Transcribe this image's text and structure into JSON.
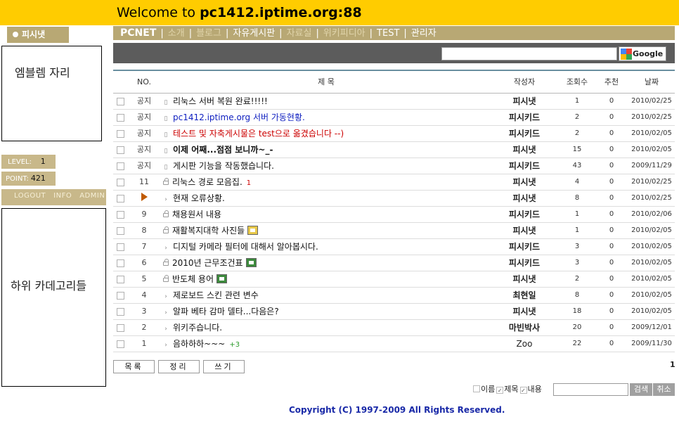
{
  "header": {
    "welcome": "Welcome to",
    "host": "pc1412.iptime.org:88"
  },
  "user_badge": "피시냇",
  "emblem": "엠블렘 자리",
  "level": {
    "label": "LEVEL:",
    "value": "1"
  },
  "point": {
    "label": "POINT:",
    "value": "421"
  },
  "login_links": [
    "LOGOUT",
    "INFO",
    "ADMIN"
  ],
  "subcategory": "하위 카데고리들",
  "nav": [
    {
      "label": "PCNET",
      "style": "brand"
    },
    {
      "label": "소개",
      "style": "dim"
    },
    {
      "label": "블로그",
      "style": "dim"
    },
    {
      "label": "자유게시판",
      "style": "normal"
    },
    {
      "label": "자료실",
      "style": "dim"
    },
    {
      "label": "위키피디아",
      "style": "dim"
    },
    {
      "label": "TEST",
      "style": "normal"
    },
    {
      "label": "관리자",
      "style": "normal"
    }
  ],
  "search_button": "Google",
  "columns": {
    "no": "NO.",
    "title": "제 목",
    "author": "작성자",
    "hits": "조회수",
    "rec": "추천",
    "date": "날짜"
  },
  "rows": [
    {
      "no": "공지",
      "icon": "doc",
      "title": "리눅스 서버 복원 완료!!!!!",
      "style": "",
      "author": "피시냇",
      "hits": "1",
      "rec": "0",
      "date": "2010/02/25"
    },
    {
      "no": "공지",
      "icon": "doc",
      "title": "pc1412.iptime.org 서버 가동현황.",
      "style": "link",
      "author": "피시키드",
      "hits": "2",
      "rec": "0",
      "date": "2010/02/25"
    },
    {
      "no": "공지",
      "icon": "doc",
      "title": "테스트 및 자축게시물은 test으로 옮겼습니다 --)",
      "style": "red",
      "author": "피시키드",
      "hits": "2",
      "rec": "0",
      "date": "2010/02/05"
    },
    {
      "no": "공지",
      "icon": "doc",
      "title": "이제 어째...점점 보니까~_-",
      "style": "bold",
      "author": "피시냇",
      "hits": "15",
      "rec": "0",
      "date": "2010/02/05"
    },
    {
      "no": "공지",
      "icon": "doc",
      "title": "게시판 기능을 작동했습니다.",
      "style": "",
      "author": "피시키드",
      "hits": "43",
      "rec": "0",
      "date": "2009/11/29"
    },
    {
      "no": "11",
      "icon": "lock",
      "title": "리눅스 경로 모음집.",
      "comments": "1",
      "style": "",
      "author": "피시냇",
      "hits": "4",
      "rec": "0",
      "date": "2010/02/25"
    },
    {
      "no": "",
      "icon": "reply",
      "current": true,
      "title": "현재 오류상황.",
      "style": "",
      "author": "피시냇",
      "hits": "8",
      "rec": "0",
      "date": "2010/02/25"
    },
    {
      "no": "9",
      "icon": "lock",
      "title": "채용원서 내용",
      "style": "",
      "author": "피시키드",
      "hits": "1",
      "rec": "0",
      "date": "2010/02/06"
    },
    {
      "no": "8",
      "icon": "lock",
      "title": "재활복지대학 사진들",
      "attach": "ppt",
      "style": "",
      "author": "피시냇",
      "hits": "1",
      "rec": "0",
      "date": "2010/02/05"
    },
    {
      "no": "7",
      "icon": "reply",
      "title": "디지털 카메라 필터에 대해서 알아봅시다.",
      "style": "",
      "author": "피시키드",
      "hits": "3",
      "rec": "0",
      "date": "2010/02/05"
    },
    {
      "no": "6",
      "icon": "lock",
      "title": "2010년 근무조건표",
      "attach": "xls",
      "style": "",
      "author": "피시키드",
      "hits": "3",
      "rec": "0",
      "date": "2010/02/05"
    },
    {
      "no": "5",
      "icon": "lock",
      "title": "반도체 용어",
      "attach": "xls",
      "style": "",
      "author": "피시냇",
      "hits": "2",
      "rec": "0",
      "date": "2010/02/05"
    },
    {
      "no": "4",
      "icon": "reply",
      "title": "제로보드 스킨 관련 변수",
      "style": "",
      "author": "최현일",
      "hits": "8",
      "rec": "0",
      "date": "2010/02/05"
    },
    {
      "no": "3",
      "icon": "reply",
      "title": "알파 베타 감마 델타...다음은?",
      "style": "",
      "author": "피시냇",
      "hits": "18",
      "rec": "0",
      "date": "2010/02/05"
    },
    {
      "no": "2",
      "icon": "reply",
      "title": "위키주습니다.",
      "style": "",
      "author": "마빈박사",
      "hits": "20",
      "rec": "0",
      "date": "2009/12/01"
    },
    {
      "no": "1",
      "icon": "reply",
      "title": "음하하하~~~",
      "comments": "+3",
      "comments_style": "green",
      "style": "",
      "author": "Zoo",
      "hits": "22",
      "rec": "0",
      "date": "2009/11/30",
      "author_normal": true
    }
  ],
  "buttons": {
    "list": "목록",
    "sort": "정리",
    "write": "쓰기"
  },
  "page": "1",
  "filters": [
    {
      "label": "이름",
      "checked": false
    },
    {
      "label": "제목",
      "checked": true
    },
    {
      "label": "내용",
      "checked": true
    }
  ],
  "search": {
    "submit": "검색",
    "cancel": "취소"
  },
  "footer": "Copyright (C) 1997-2009 All Rights Reserved."
}
